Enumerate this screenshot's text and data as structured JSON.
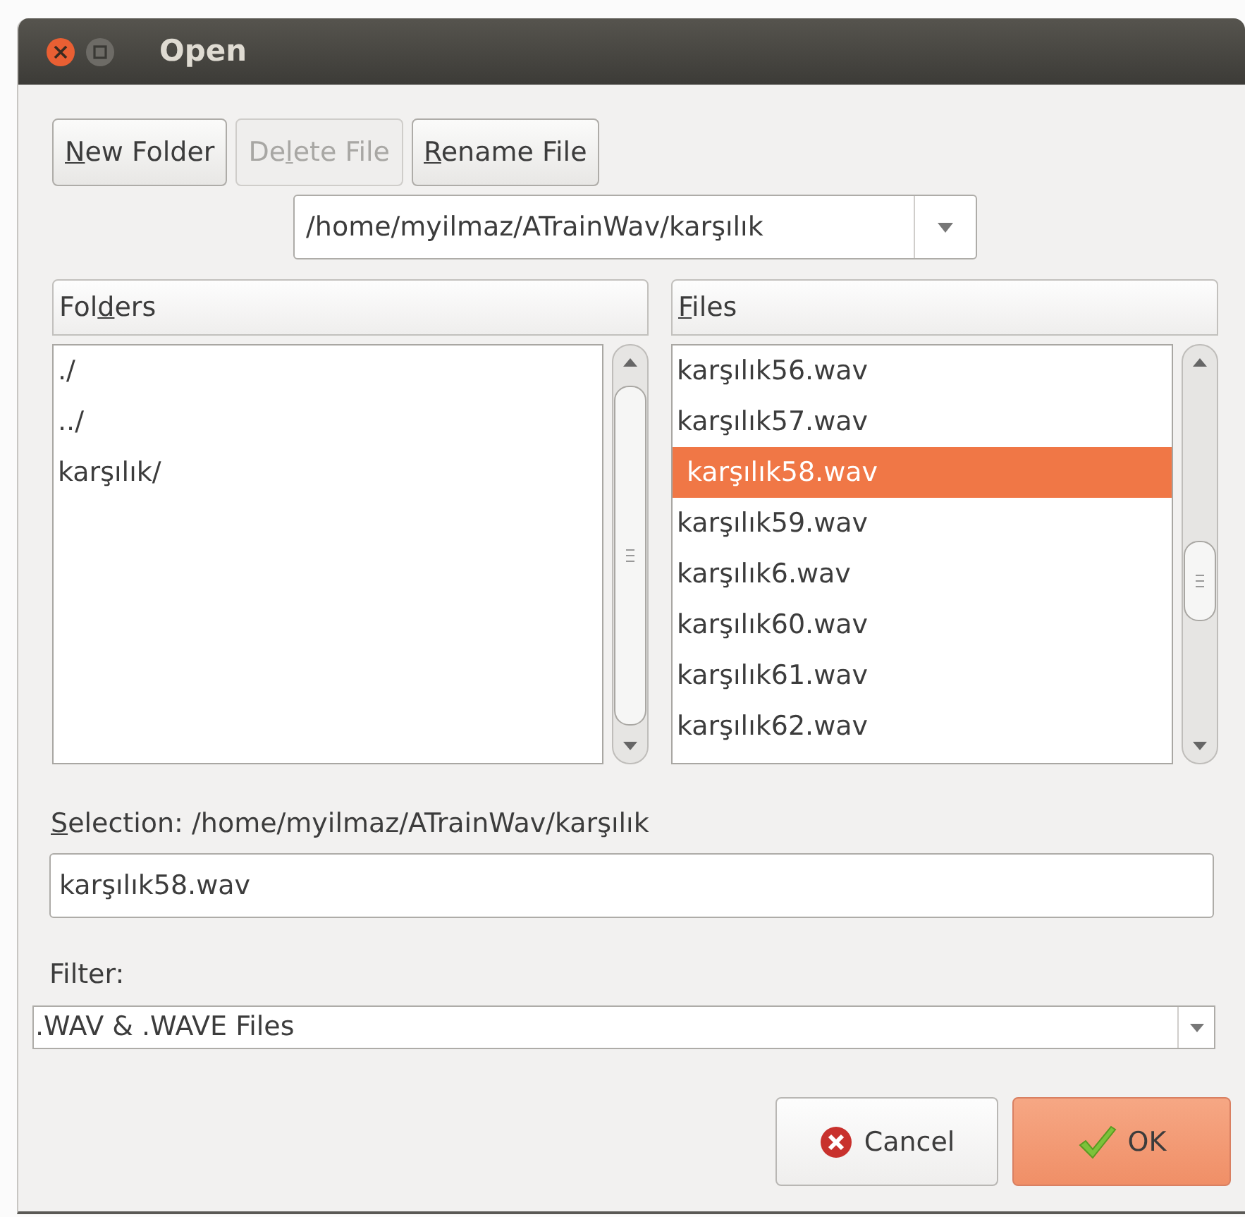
{
  "window": {
    "title": "Open"
  },
  "toolbar": [
    {
      "label": [
        {
          "text": "N",
          "underline": true
        },
        {
          "text": "ew Folder",
          "underline": false
        }
      ],
      "disabled": false
    },
    {
      "label": [
        {
          "text": "De",
          "underline": false
        },
        {
          "text": "l",
          "underline": true
        },
        {
          "text": "ete File",
          "underline": false
        }
      ],
      "disabled": true
    },
    {
      "label": [
        {
          "text": "R",
          "underline": true
        },
        {
          "text": "ename File",
          "underline": false
        }
      ],
      "disabled": false
    }
  ],
  "path_combo": {
    "value": "/home/myilmaz/ATrainWav/karşılık"
  },
  "folders": {
    "header": [
      {
        "text": "Fol",
        "underline": false
      },
      {
        "text": "d",
        "underline": true
      },
      {
        "text": "ers",
        "underline": false
      }
    ],
    "items": [
      {
        "label": "./",
        "selected": false
      },
      {
        "label": "../",
        "selected": false
      },
      {
        "label": "karşılık/",
        "selected": false
      }
    ]
  },
  "files": {
    "header": [
      {
        "text": "F",
        "underline": true
      },
      {
        "text": "iles",
        "underline": false
      }
    ],
    "items": [
      {
        "label": "karşılık56.wav",
        "selected": false
      },
      {
        "label": "karşılık57.wav",
        "selected": false
      },
      {
        "label": "karşılık58.wav",
        "selected": true
      },
      {
        "label": "karşılık59.wav",
        "selected": false
      },
      {
        "label": "karşılık6.wav",
        "selected": false
      },
      {
        "label": "karşılık60.wav",
        "selected": false
      },
      {
        "label": "karşılık61.wav",
        "selected": false
      },
      {
        "label": "karşılık62.wav",
        "selected": false
      }
    ]
  },
  "selection": {
    "label": [
      {
        "text": "S",
        "underline": true
      },
      {
        "text": "election: /home/myilmaz/ATrainWav/karşılık",
        "underline": false
      }
    ],
    "value": "karşılık58.wav"
  },
  "filter": {
    "label": "Filter:",
    "value": ".WAV & .WAVE Files"
  },
  "buttons": [
    {
      "kind": "cancel",
      "label": "Cancel"
    },
    {
      "kind": "ok",
      "label": "OK"
    }
  ]
}
